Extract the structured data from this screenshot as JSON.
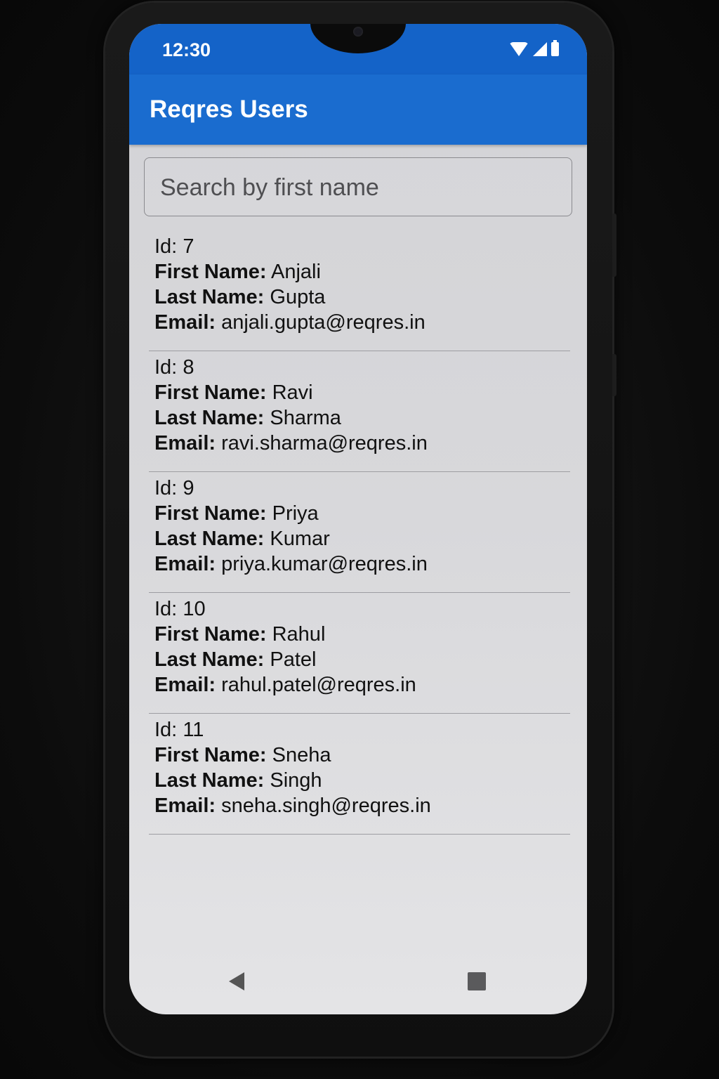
{
  "status_bar": {
    "time": "12:30",
    "icons": [
      "wifi-icon",
      "signal-icon",
      "battery-icon"
    ]
  },
  "app_bar": {
    "title": "Reqres Users",
    "color": "#1a6ccf"
  },
  "search": {
    "placeholder": "Search by first name",
    "value": ""
  },
  "labels": {
    "id": "Id:",
    "first_name": "First Name:",
    "last_name": "Last Name:",
    "email": "Email:"
  },
  "users": [
    {
      "id": "7",
      "first_name": "Anjali",
      "last_name": "Gupta",
      "email": "anjali.gupta@reqres.in"
    },
    {
      "id": "8",
      "first_name": "Ravi",
      "last_name": "Sharma",
      "email": "ravi.sharma@reqres.in"
    },
    {
      "id": "9",
      "first_name": "Priya",
      "last_name": "Kumar",
      "email": "priya.kumar@reqres.in"
    },
    {
      "id": "10",
      "first_name": "Rahul",
      "last_name": "Patel",
      "email": "rahul.patel@reqres.in"
    },
    {
      "id": "11",
      "first_name": "Sneha",
      "last_name": "Singh",
      "email": "sneha.singh@reqres.in"
    }
  ],
  "nav_bar": {
    "icons": [
      "back-icon",
      "recents-icon"
    ]
  },
  "colors": {
    "status_bar": "#1463c8",
    "app_bar": "#1a6ccf",
    "background": "#d8d8db"
  }
}
